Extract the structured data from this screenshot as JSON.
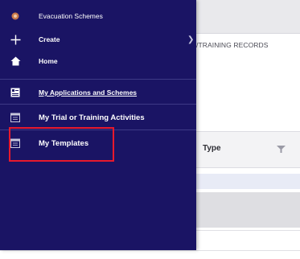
{
  "background": {
    "breadcrumb": "/TRAINING RECORDS",
    "table": {
      "column_header": "Type"
    }
  },
  "drawer": {
    "app_title": "Evacuation Schemes",
    "create_label": "Create",
    "home_label": "Home",
    "items": [
      {
        "label": "My Applications and Schemes"
      },
      {
        "label": "My Trial or Training Activities"
      },
      {
        "label": "My Templates"
      }
    ]
  },
  "colors": {
    "drawer_bg": "#1a1464",
    "highlight": "#e8192c"
  }
}
